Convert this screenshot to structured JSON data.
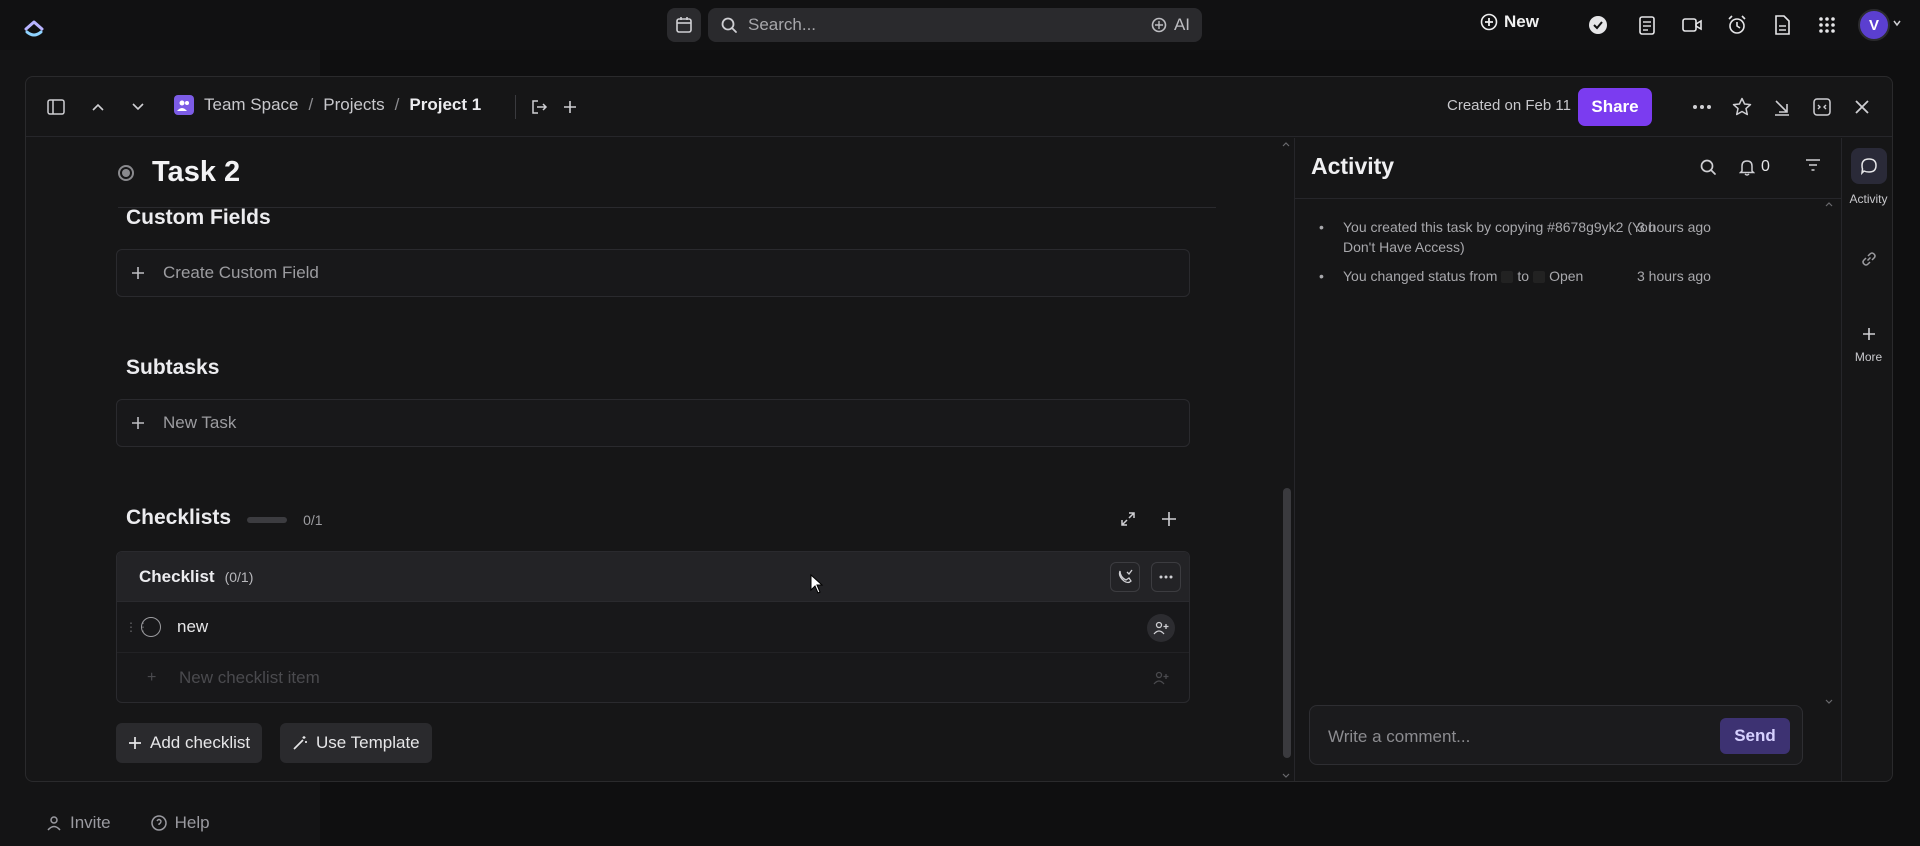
{
  "topbar": {
    "search_placeholder": "Search...",
    "ai_label": "AI",
    "new_label": "New",
    "avatar_initial": "V"
  },
  "background": {
    "invite_label": "Invite",
    "help_label": "Help"
  },
  "modal": {
    "breadcrumbs": [
      "Team Space",
      "Projects",
      "Project 1"
    ],
    "created_text": "Created on Feb 11",
    "share_label": "Share"
  },
  "task": {
    "title": "Task 2",
    "custom_fields": {
      "heading": "Custom Fields",
      "create_label": "Create Custom Field"
    },
    "subtasks": {
      "heading": "Subtasks",
      "new_label": "New Task"
    },
    "checklists": {
      "heading": "Checklists",
      "progress_text": "0/1",
      "progress_fraction": 0,
      "checklist": {
        "name": "Checklist",
        "count": "(0/1)",
        "items": [
          "new"
        ],
        "new_item_placeholder": "New checklist item"
      },
      "add_checklist_label": "Add checklist",
      "use_template_label": "Use Template"
    }
  },
  "activity": {
    "title": "Activity",
    "notification_count": "0",
    "entries": [
      {
        "text": "You created this task by copying #8678g9yk2 (You Don't Have Access)",
        "time": "3 hours ago"
      },
      {
        "text_before": "You changed status from",
        "text_mid": "to",
        "text_after": "Open",
        "time": "3 hours ago"
      }
    ],
    "comment_placeholder": "Write a comment...",
    "send_label": "Send"
  },
  "rail": {
    "activity_label": "Activity",
    "more_label": "More"
  },
  "colors": {
    "accent": "#7b3cf0",
    "background": "#161617"
  }
}
